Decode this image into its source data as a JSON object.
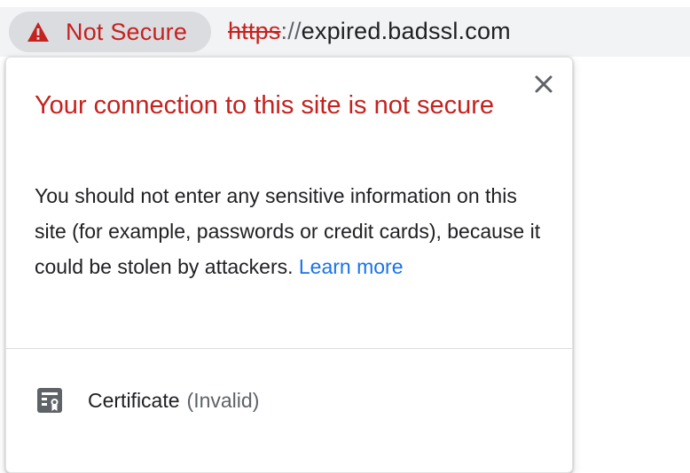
{
  "omnibox": {
    "security_chip_label": "Not Secure",
    "url_scheme": "https",
    "url_separator": "://",
    "url_host": "expired.badssl.com"
  },
  "popup": {
    "title": "Your connection to this site is not secure",
    "body_text": "You should not enter any sensitive information on this site (for example, passwords or credit cards), because it could be stolen by attackers. ",
    "learn_more_label": "Learn more",
    "certificate_label": "Certificate",
    "certificate_status": "(Invalid)"
  },
  "colors": {
    "danger_red": "#c5221f",
    "link_blue": "#1a73e8",
    "chip_gray": "#dadce0",
    "omnibox_gray": "#f1f3f4"
  },
  "icons": {
    "chip": "warning-triangle-icon",
    "close": "close-icon",
    "certificate": "certificate-icon"
  }
}
